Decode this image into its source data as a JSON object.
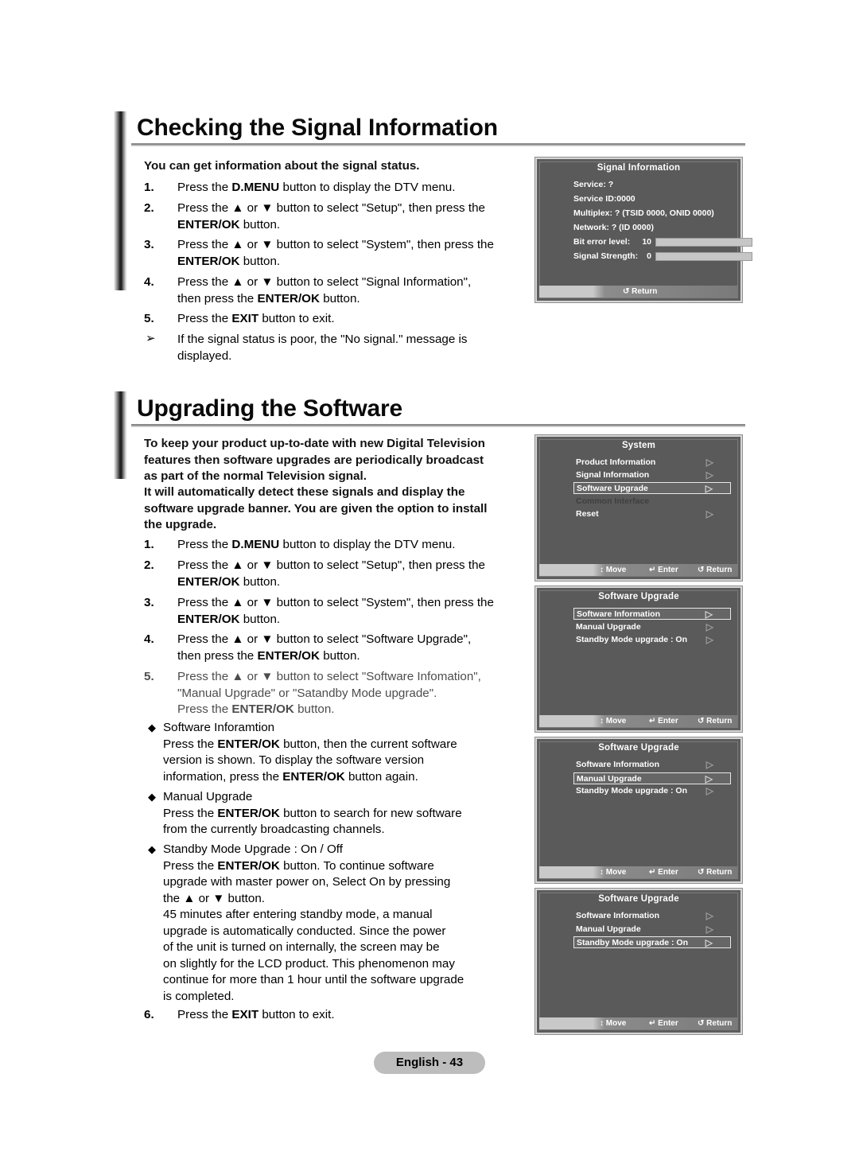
{
  "page": {
    "footer_label": "English - 43"
  },
  "sections": [
    {
      "heading": "Checking the Signal Information",
      "intro": "You can get information about the signal status.",
      "steps": [
        {
          "num": "1.",
          "text": "Press the D.MENU button to display the DTV menu."
        },
        {
          "num": "2.",
          "text": "Press the ▲ or ▼ button to select \"Setup\", then press the ENTER/OK button."
        },
        {
          "num": "3.",
          "text": "Press the ▲ or ▼ button to select \"System\", then press the ENTER/OK button."
        },
        {
          "num": "4.",
          "text": "Press the ▲ or ▼ button to select \"Signal Information\", then press the ENTER/OK button."
        },
        {
          "num": "5.",
          "text": "Press the EXIT button to exit."
        },
        {
          "num": "➢",
          "text": "If the signal status is poor, the \"No signal.\" message is displayed."
        }
      ]
    },
    {
      "heading": "Upgrading the Software",
      "intro1": "To keep your product up-to-date with new Digital Television features then software upgrades are periodically broadcast as part of the normal Television signal.",
      "intro2": "It will automatically detect these signals and display the software upgrade banner. You are given the option to install the upgrade.",
      "steps": [
        {
          "num": "1.",
          "text": "Press the D.MENU button to display the DTV menu."
        },
        {
          "num": "2.",
          "text": "Press the ▲ or ▼ button to select \"Setup\", then press the ENTER/OK button."
        },
        {
          "num": "3.",
          "text": "Press the ▲ or ▼ button to select \"System\", then press the ENTER/OK button."
        },
        {
          "num": "4.",
          "text": "Press the ▲ or ▼ button to select \"Software Upgrade\", then press the ENTER/OK button."
        },
        {
          "num": "5.",
          "text": "Press the ▲ or ▼ button to select \"Software Infomation\", \"Manual Upgrade\" or \"Satandby Mode upgrade\". Press the ENTER/OK button."
        }
      ],
      "bullets": [
        {
          "marker": "◆",
          "title": "Software Inforamtion",
          "body": "Press the ENTER/OK button, then the current software version is shown. To display the software version information, press the ENTER/OK button again."
        },
        {
          "marker": "◆",
          "title": "Manual Upgrade",
          "body": "Press the ENTER/OK button to search for new software from the currently broadcasting channels."
        },
        {
          "marker": "◆",
          "title": "Standby Mode Upgrade : On / Off",
          "body": "Press the ENTER/OK button. To continue software upgrade with master power on, Select On by pressing the ▲ or ▼ button.\n45 minutes after entering standby mode, a manual upgrade is automatically conducted. Since the power of the unit is turned on internally, the screen may be on slightly for the LCD product. This phenomenon may continue for more than 1 hour until the software upgrade is completed."
        }
      ],
      "final_step": {
        "num": "6.",
        "text": "Press the EXIT button to exit."
      }
    }
  ],
  "osd_panels": {
    "signal_information": {
      "title": "Signal Information",
      "lines": [
        "Service: ?",
        "Service ID:0000",
        "Multiplex: ? (TSID 0000, ONID 0000)",
        "Network: ? (ID 0000)"
      ],
      "meters": [
        {
          "label": "Bit error level:",
          "value": "10",
          "fill_percent": 0
        },
        {
          "label": "Signal Strength:",
          "value": "0",
          "fill_percent": 0
        }
      ],
      "footer": [
        {
          "icon": "↺",
          "label": "Return"
        }
      ]
    },
    "system_menu": {
      "title": "System",
      "items": [
        {
          "label": "Product Information",
          "selected": false,
          "dim": false,
          "arrow": "▷"
        },
        {
          "label": "Signal Information",
          "selected": false,
          "dim": false,
          "arrow": "▷"
        },
        {
          "label": "Software Upgrade",
          "selected": true,
          "dim": false,
          "arrow": "▷"
        },
        {
          "label": "Common Interface",
          "selected": false,
          "dim": true,
          "arrow": ""
        },
        {
          "label": "Reset",
          "selected": false,
          "dim": false,
          "arrow": "▷"
        }
      ],
      "footer": [
        {
          "icon": "↕",
          "label": "Move"
        },
        {
          "icon": "↵",
          "label": "Enter"
        },
        {
          "icon": "↺",
          "label": "Return"
        }
      ]
    },
    "software_upgrade_1": {
      "title": "Software Upgrade",
      "items": [
        {
          "label": "Software Information",
          "selected": true,
          "dim": false,
          "arrow": "▷"
        },
        {
          "label": "Manual Upgrade",
          "selected": false,
          "dim": false,
          "arrow": "▷"
        },
        {
          "label": "Standby Mode upgrade : On",
          "selected": false,
          "dim": false,
          "arrow": "▷"
        }
      ],
      "footer": [
        {
          "icon": "↕",
          "label": "Move"
        },
        {
          "icon": "↵",
          "label": "Enter"
        },
        {
          "icon": "↺",
          "label": "Return"
        }
      ]
    },
    "software_upgrade_2": {
      "title": "Software Upgrade",
      "items": [
        {
          "label": "Software Information",
          "selected": false,
          "dim": false,
          "arrow": "▷"
        },
        {
          "label": "Manual Upgrade",
          "selected": true,
          "dim": false,
          "arrow": "▷"
        },
        {
          "label": "Standby Mode upgrade : On",
          "selected": false,
          "dim": false,
          "arrow": "▷"
        }
      ],
      "footer": [
        {
          "icon": "↕",
          "label": "Move"
        },
        {
          "icon": "↵",
          "label": "Enter"
        },
        {
          "icon": "↺",
          "label": "Return"
        }
      ]
    },
    "software_upgrade_3": {
      "title": "Software Upgrade",
      "items": [
        {
          "label": "Software Information",
          "selected": false,
          "dim": false,
          "arrow": "▷"
        },
        {
          "label": "Manual Upgrade",
          "selected": false,
          "dim": false,
          "arrow": "▷"
        },
        {
          "label": "Standby Mode upgrade : On",
          "selected": true,
          "dim": false,
          "arrow": "▷"
        }
      ],
      "footer": [
        {
          "icon": "↕",
          "label": "Move"
        },
        {
          "icon": "↵",
          "label": "Enter"
        },
        {
          "icon": "↺",
          "label": "Return"
        }
      ]
    }
  }
}
